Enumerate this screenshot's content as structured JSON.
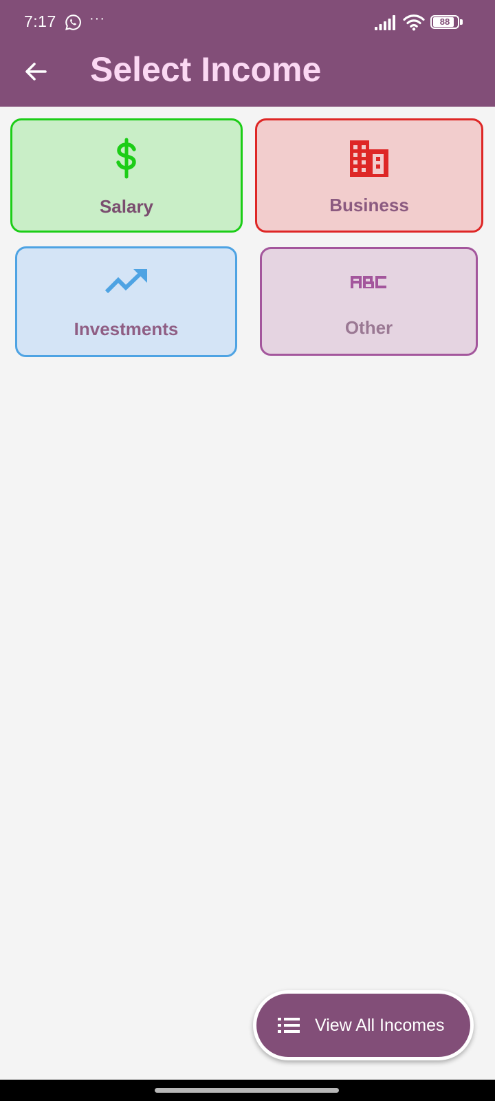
{
  "status_bar": {
    "time": "7:17",
    "more_indicator": "···",
    "battery_level": "88",
    "battery_fraction": 0.88,
    "icons": [
      "whatsapp-icon",
      "signal-icon",
      "wifi-icon",
      "battery-icon"
    ]
  },
  "header": {
    "title": "Select Income",
    "back_icon": "arrow-left-icon"
  },
  "categories": [
    {
      "label": "Salary",
      "icon": "dollar-icon",
      "accent": "#1ccd17",
      "background": "#c9eec7",
      "label_color": "#7a4d6f"
    },
    {
      "label": "Business",
      "icon": "building-icon",
      "accent": "#de2726",
      "background": "#f2cdcd",
      "label_color": "#8b5a80"
    },
    {
      "label": "Investments",
      "icon": "trending-up-icon",
      "accent": "#4ea3e3",
      "background": "#d4e4f6",
      "label_color": "#8f5e84"
    },
    {
      "label": "Other",
      "icon": "abc-icon",
      "accent": "#a3569c",
      "background": "#e5d4e1",
      "label_color": "#9a7893"
    }
  ],
  "fab": {
    "label": "View All Incomes",
    "icon": "list-icon"
  },
  "colors": {
    "primary": "#824e78",
    "title_text": "#fbd8f3",
    "background": "#f4f4f4"
  }
}
